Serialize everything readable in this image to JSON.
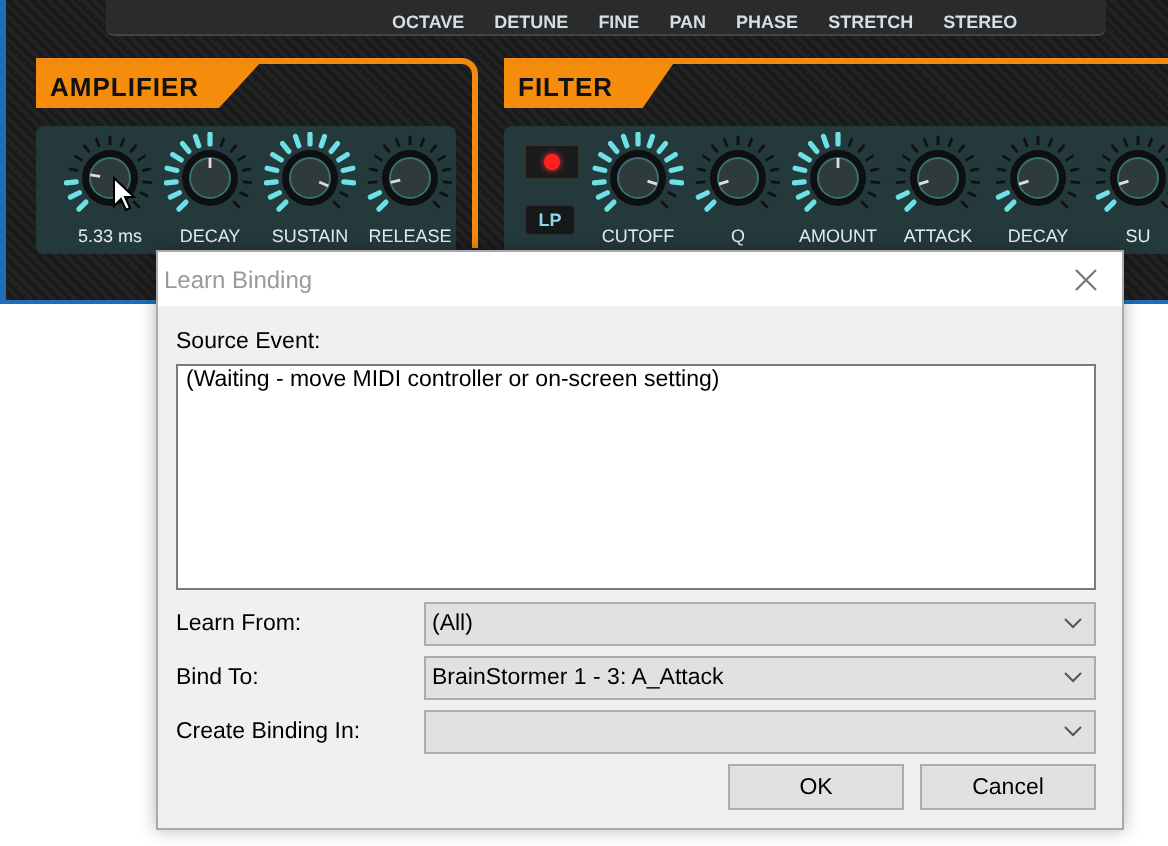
{
  "top_strip": {
    "labels": [
      "OCTAVE",
      "DETUNE",
      "FINE",
      "PAN",
      "PHASE",
      "STRETCH",
      "STEREO"
    ]
  },
  "amplifier": {
    "title": "AMPLIFIER",
    "knobs": [
      {
        "label": "5.33 ms",
        "level": 0.2,
        "hovered": true
      },
      {
        "label": "DECAY",
        "level": 0.5,
        "hovered": false
      },
      {
        "label": "SUSTAIN",
        "level": 0.92,
        "hovered": false
      },
      {
        "label": "RELEASE",
        "level": 0.12,
        "hovered": false
      }
    ]
  },
  "filter": {
    "title": "FILTER",
    "led": {
      "on": true
    },
    "mode_button": {
      "label": "LP"
    },
    "knobs": [
      {
        "label": "CUTOFF",
        "level": 0.9,
        "hovered": false
      },
      {
        "label": "Q",
        "level": 0.1,
        "hovered": false
      },
      {
        "label": "AMOUNT",
        "level": 0.5,
        "hovered": false
      },
      {
        "label": "ATTACK",
        "level": 0.1,
        "hovered": false
      },
      {
        "label": "DECAY",
        "level": 0.1,
        "hovered": false
      },
      {
        "label": "SU",
        "level": 0.1,
        "hovered": false
      }
    ]
  },
  "dialog": {
    "title": "Learn Binding",
    "source_label": "Source Event:",
    "source_text": "(Waiting - move MIDI controller or on-screen setting)",
    "fields": [
      {
        "label": "Learn From:",
        "value": "(All)"
      },
      {
        "label": "Bind To:",
        "value": "BrainStormer 1 - 3: A_Attack"
      },
      {
        "label": "Create Binding In:"
      }
    ],
    "buttons": [
      "OK",
      "Cancel"
    ]
  }
}
